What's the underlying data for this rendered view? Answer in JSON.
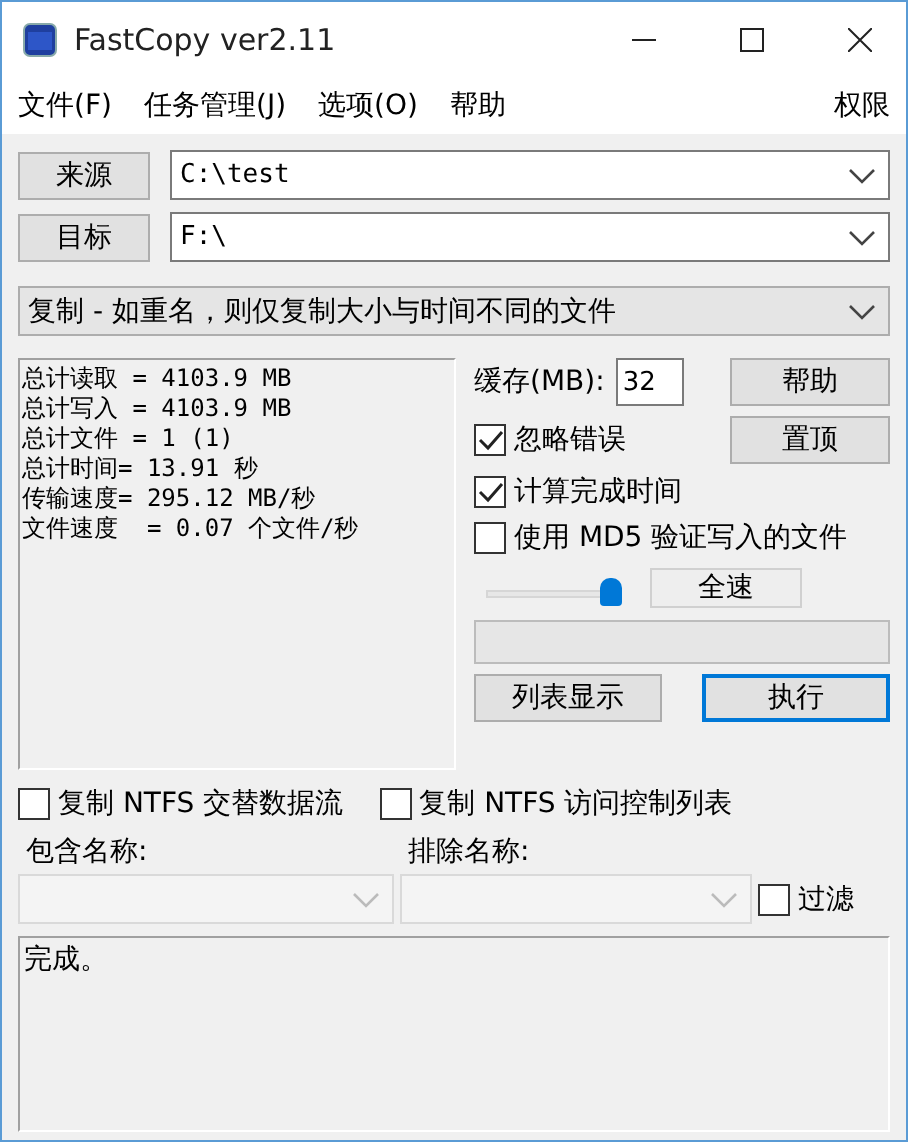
{
  "window": {
    "title": "FastCopy ver2.11"
  },
  "menu": [
    {
      "label": "文件(F)"
    },
    {
      "label": "任务管理(J)"
    },
    {
      "label": "选项(O)"
    },
    {
      "label": "帮助"
    }
  ],
  "menu_right": "权限",
  "paths": [
    {
      "button": "来源",
      "value": "C:\\test"
    },
    {
      "button": "目标",
      "value": "F:\\"
    }
  ],
  "mode": "复制 - 如重名，则仅复制大小与时间不同的文件",
  "stats": [
    "总计读取 = 4103.9 MB",
    "总计写入 = 4103.9 MB",
    "总计文件 = 1 (1)",
    "总计时间= 13.91 秒",
    "传输速度= 295.12 MB/秒",
    "文件速度  = 0.07 个文件/秒"
  ],
  "buffer": {
    "label": "缓存(MB):",
    "value": "32"
  },
  "side_buttons": [
    "帮助",
    "置顶"
  ],
  "options": [
    {
      "label": "忽略错误",
      "checked": true
    },
    {
      "label": "计算完成时间",
      "checked": true
    },
    {
      "label": "使用 MD5 验证写入的文件",
      "checked": false
    }
  ],
  "speed": {
    "level": 1,
    "label": "全速"
  },
  "action_buttons": [
    {
      "label": "列表显示",
      "default": false
    },
    {
      "label": "执行",
      "default": true
    }
  ],
  "ntfs_options": [
    {
      "label": "复制 NTFS 交替数据流",
      "checked": false
    },
    {
      "label": "复制 NTFS 访问控制列表",
      "checked": false
    }
  ],
  "include_label": "包含名称:",
  "exclude_label": "排除名称:",
  "filter": {
    "label": "过滤",
    "checked": false
  },
  "log": "完成。"
}
